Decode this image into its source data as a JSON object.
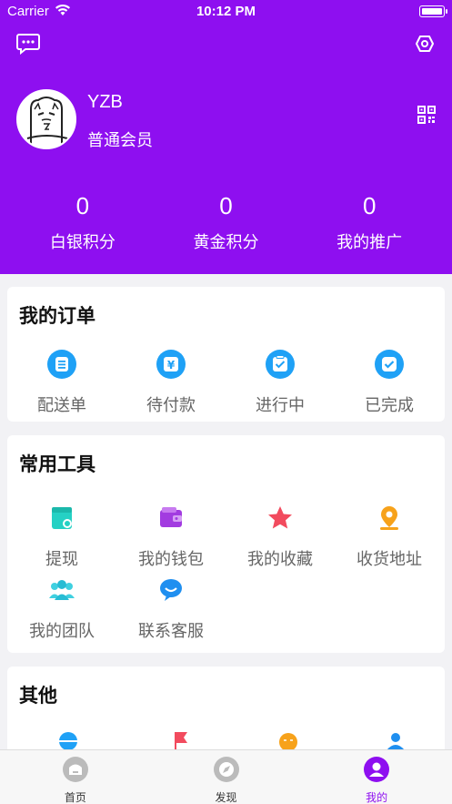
{
  "status_bar": {
    "carrier": "Carrier",
    "time": "10:12 PM"
  },
  "profile": {
    "username": "YZB",
    "member_level": "普通会员"
  },
  "stats": [
    {
      "value": "0",
      "label": "白银积分"
    },
    {
      "value": "0",
      "label": "黄金积分"
    },
    {
      "value": "0",
      "label": "我的推广"
    }
  ],
  "orders": {
    "title": "我的订单",
    "items": [
      {
        "label": "配送单",
        "icon": "delivery-list-icon"
      },
      {
        "label": "待付款",
        "icon": "yuan-icon"
      },
      {
        "label": "进行中",
        "icon": "in-progress-icon"
      },
      {
        "label": "已完成",
        "icon": "completed-check-icon"
      }
    ]
  },
  "tools": {
    "title": "常用工具",
    "items": [
      {
        "label": "提现",
        "icon": "withdraw-icon"
      },
      {
        "label": "我的钱包",
        "icon": "wallet-icon"
      },
      {
        "label": "我的收藏",
        "icon": "star-icon"
      },
      {
        "label": "收货地址",
        "icon": "location-pin-icon"
      },
      {
        "label": "我的团队",
        "icon": "team-icon"
      },
      {
        "label": "联系客服",
        "icon": "chat-bubble-icon"
      }
    ]
  },
  "other": {
    "title": "其他"
  },
  "tabbar": [
    {
      "label": "首页",
      "icon": "home-icon",
      "active": false
    },
    {
      "label": "发现",
      "icon": "compass-icon",
      "active": false
    },
    {
      "label": "我的",
      "icon": "user-icon",
      "active": true
    }
  ],
  "colors": {
    "brand": "#8e0ff0",
    "accent_blue": "#1fa1f6"
  }
}
